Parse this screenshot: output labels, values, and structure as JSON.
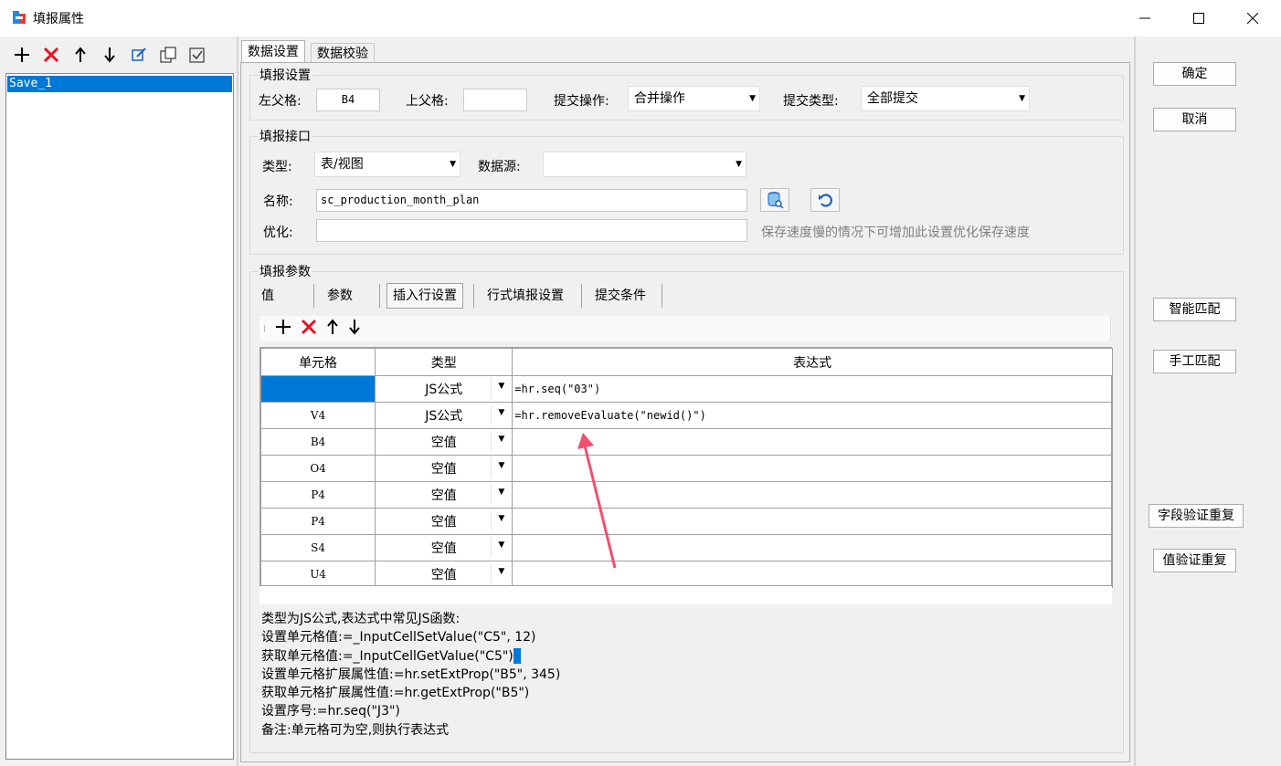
{
  "window": {
    "title": "填报属性"
  },
  "left_pane": {
    "items": [
      "Save_1"
    ]
  },
  "tabs": {
    "data_settings": "数据设置",
    "data_validate": "数据校验"
  },
  "fill_settings": {
    "legend": "填报设置",
    "left_parent_label": "左父格:",
    "left_parent_value": "B4",
    "top_parent_label": "上父格:",
    "top_parent_value": "",
    "submit_op_label": "提交操作:",
    "submit_op_value": "合并操作",
    "submit_type_label": "提交类型:",
    "submit_type_value": "全部提交"
  },
  "interface": {
    "legend": "填报接口",
    "type_label": "类型:",
    "type_value": "表/视图",
    "datasource_label": "数据源:",
    "datasource_value": "",
    "name_label": "名称:",
    "name_value": "sc_production_month_plan",
    "optimize_label": "优化:",
    "optimize_value": "",
    "optimize_hint": "保存速度慢的情况下可增加此设置优化保存速度"
  },
  "params": {
    "legend": "填报参数",
    "subtabs": [
      "值",
      "参数",
      "插入行设置",
      "行式填报设置",
      "提交条件"
    ],
    "columns": [
      "单元格",
      "类型",
      "表达式"
    ],
    "rows": [
      {
        "cell": "",
        "type": "JS公式",
        "expr": "=hr.seq(\"03\")"
      },
      {
        "cell": "V4",
        "type": "JS公式",
        "expr": "=hr.removeEvaluate(\"newid()\")"
      },
      {
        "cell": "B4",
        "type": "空值",
        "expr": ""
      },
      {
        "cell": "O4",
        "type": "空值",
        "expr": ""
      },
      {
        "cell": "P4",
        "type": "空值",
        "expr": ""
      },
      {
        "cell": "P4",
        "type": "空值",
        "expr": ""
      },
      {
        "cell": "S4",
        "type": "空值",
        "expr": ""
      },
      {
        "cell": "U4",
        "type": "空值",
        "expr": ""
      }
    ]
  },
  "help": {
    "lines": [
      "类型为JS公式,表达式中常见JS函数:",
      "设置单元格值:=_InputCellSetValue(\"C5\", 12)",
      "获取单元格值:=_InputCellGetValue(\"C5\")",
      "设置单元格扩展属性值:=hr.setExtProp(\"B5\", 345)",
      "获取单元格扩展属性值:=hr.getExtProp(\"B5\")",
      "设置序号:=hr.seq(\"J3\")",
      "备注:单元格可为空,则执行表达式"
    ]
  },
  "buttons": {
    "ok": "确定",
    "cancel": "取消",
    "smart_match": "智能匹配",
    "manual_match": "手工匹配",
    "field_dup": "字段验证重复",
    "value_dup": "值验证重复"
  },
  "colors": {
    "selection": "#0078d7",
    "delete": "#e81123",
    "annotation_arrow": "#f0506e"
  }
}
